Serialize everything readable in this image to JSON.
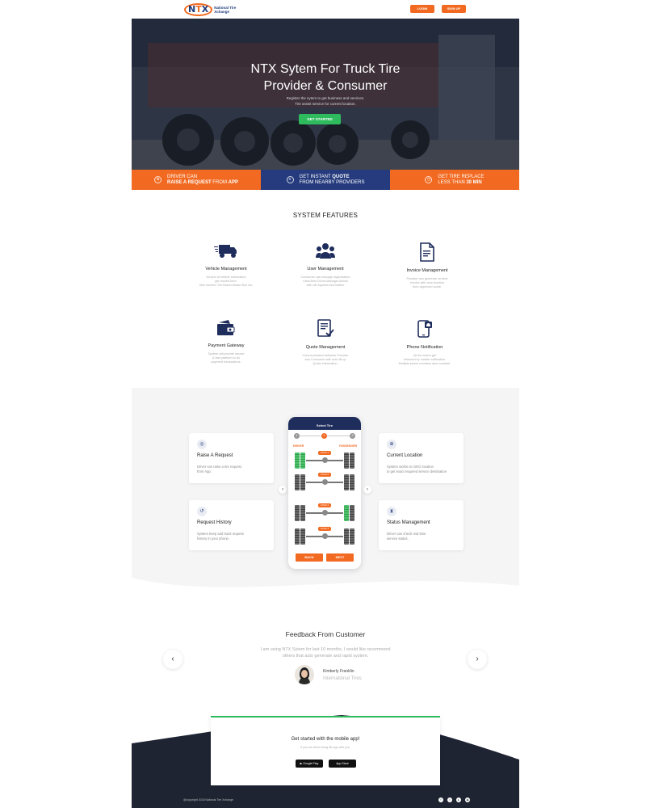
{
  "header": {
    "logo_mark": "NTX",
    "logo_text": "National Tire Xchange",
    "login_label": "LOGIN",
    "signup_label": "SIGN UP"
  },
  "hero": {
    "title_line1": "NTX Sytem For Truck Tire",
    "title_line2": "Provider & Consumer",
    "sub_line1": "Register the sytem to get business and services.",
    "sub_line2": "Tire assist service for current location.",
    "cta_label": "GET STARTED"
  },
  "band": [
    {
      "line1": "DRIVER CAN",
      "line2_bold": "RAISE A REQUEST",
      "line2_rest": " FROM ",
      "line2_bold2": "APP",
      "icon": "tire-icon"
    },
    {
      "line1_pre": "GET INSTANT ",
      "line1_bold": "QUOTE",
      "line2": "FROM NEARBY PROVIDERS",
      "icon": "document-icon"
    },
    {
      "line1": "GET TIRE REPLACE",
      "line2_pre": "LESS THAN ",
      "line2_bold": "30 MIN",
      "icon": "clock-icon"
    }
  ],
  "features": {
    "title": "SYSTEM FEATURES",
    "items": [
      {
        "name": "Vehicle Management",
        "desc1": "All kind of vehicle information",
        "desc2": "get moved here.",
        "desc3": "Slim number Tire Brand Model Size etc.",
        "icon": "truck-icon"
      },
      {
        "name": "User Management",
        "desc1": "Consumer can manage organization",
        "desc2": "roles likes Driver,Manager,Admin",
        "desc3": "with all required information",
        "icon": "users-icon"
      },
      {
        "name": "Invoice Management",
        "desc1": "Provider can generate on-time",
        "desc2": "invoice with auto function",
        "desc3": "from approved quote.",
        "icon": "invoice-icon"
      },
      {
        "name": "Payment Gateway",
        "desc1": "System will provide secure",
        "desc2": "& fast platform to do",
        "desc3": "payment transactions.",
        "icon": "wallet-icon"
      },
      {
        "name": "Quote Management",
        "desc1": "Communication between Provider",
        "desc2": "and Consumer with auto fill up",
        "desc3": "Quote information.",
        "icon": "quote-icon"
      },
      {
        "name": "Phone Notification",
        "desc1": "All the action get",
        "desc2": "informed by mobile notification.",
        "desc3": "Multiple phone numbers also consider.",
        "icon": "phone-bell-icon"
      }
    ]
  },
  "app_section": {
    "cards": [
      {
        "title": "Raise A Request",
        "desc1": "Driver can raise a tire request",
        "desc2": "from App.",
        "icon": "target-icon"
      },
      {
        "title": "Request History",
        "desc1": "System keep and track request",
        "desc2": "history in your phone.",
        "icon": "history-icon"
      },
      {
        "title": "Current Location",
        "desc1": "System works on GEO location",
        "desc2": "to get exact required service destination",
        "icon": "globe-icon"
      },
      {
        "title": "Status Management",
        "desc1": "Driver can check real time",
        "desc2": "service status.",
        "icon": "hourglass-icon"
      }
    ],
    "phone": {
      "screen_title": "Select Tire",
      "step1": "1",
      "step2": "2",
      "step3": "3",
      "left_label": "DRIVER",
      "right_label": "PASSENGER",
      "axle_labels": [
        "AXLE 1",
        "AXLE 2",
        "AXLE 3",
        "AXLE 4"
      ],
      "back_label": "BACK",
      "next_label": "NEXT"
    }
  },
  "feedback": {
    "title": "Feedback From Customer",
    "quote_line1": "I am using NTX Sytem for last 10 months, I would like recommend",
    "quote_line2": "others that auto generate and rapid system.",
    "name": "Kimberly Franklin",
    "company": "International Tires"
  },
  "footer": {
    "cta_title": "Get started with the mobile app!",
    "cta_sub": "If you are driver bring life app with you.",
    "google_play": "Google Play",
    "app_store": "App Store",
    "copyright": "@copyright 2018 National Tire Xchange",
    "colors": {
      "dark": "#1f2433",
      "accent": "#f26a21",
      "green": "#2dbb5d",
      "navy": "#253b7d"
    }
  }
}
